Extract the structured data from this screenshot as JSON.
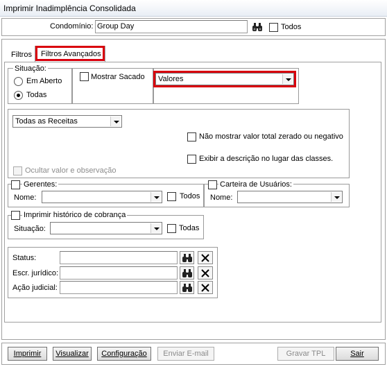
{
  "window": {
    "title": "Imprimir Inadimplência Consolidada"
  },
  "condominio": {
    "label": "Condomínio:",
    "value": "Group Day",
    "todos_label": "Todos"
  },
  "tabs": [
    {
      "label": "Filtros"
    },
    {
      "label": "Filtros Avançados"
    }
  ],
  "situacao": {
    "legend": "Situação:",
    "options": [
      "Em Aberto",
      "Todas"
    ],
    "selected": "Todas"
  },
  "mostrar_sacado": "Mostrar Sacado",
  "valores_select": "Valores",
  "receitas_select": "Todas as Receitas",
  "options": {
    "nao_mostrar": "Não mostrar valor total zerado ou negativo",
    "exibir_descricao": "Exibir a descrição no lugar das classes.",
    "ocultar": "Ocultar valor e observação"
  },
  "gerentes": {
    "label": "Gerentes:",
    "nome_label": "Nome:",
    "todos_label": "Todos"
  },
  "carteira": {
    "label": "Carteira de Usuários:",
    "nome_label": "Nome:"
  },
  "historico": {
    "label": "Imprimir histórico de cobrança",
    "situacao_label": "Situação:",
    "todas_label": "Todas"
  },
  "filters": [
    {
      "label": "Status:"
    },
    {
      "label": "Escr. jurídico:"
    },
    {
      "label": "Ação judicial:"
    }
  ],
  "buttons": {
    "imprimir": "Imprimir",
    "visualizar": "Visualizar",
    "configuracao": "Configuração",
    "enviar_email": "Enviar E-mail",
    "gravar_tpl": "Gravar TPL",
    "sair": "Sair"
  },
  "icons": {
    "search": "binoculars-icon",
    "clear": "x-icon"
  },
  "colors": {
    "highlight": "#d9000d"
  }
}
